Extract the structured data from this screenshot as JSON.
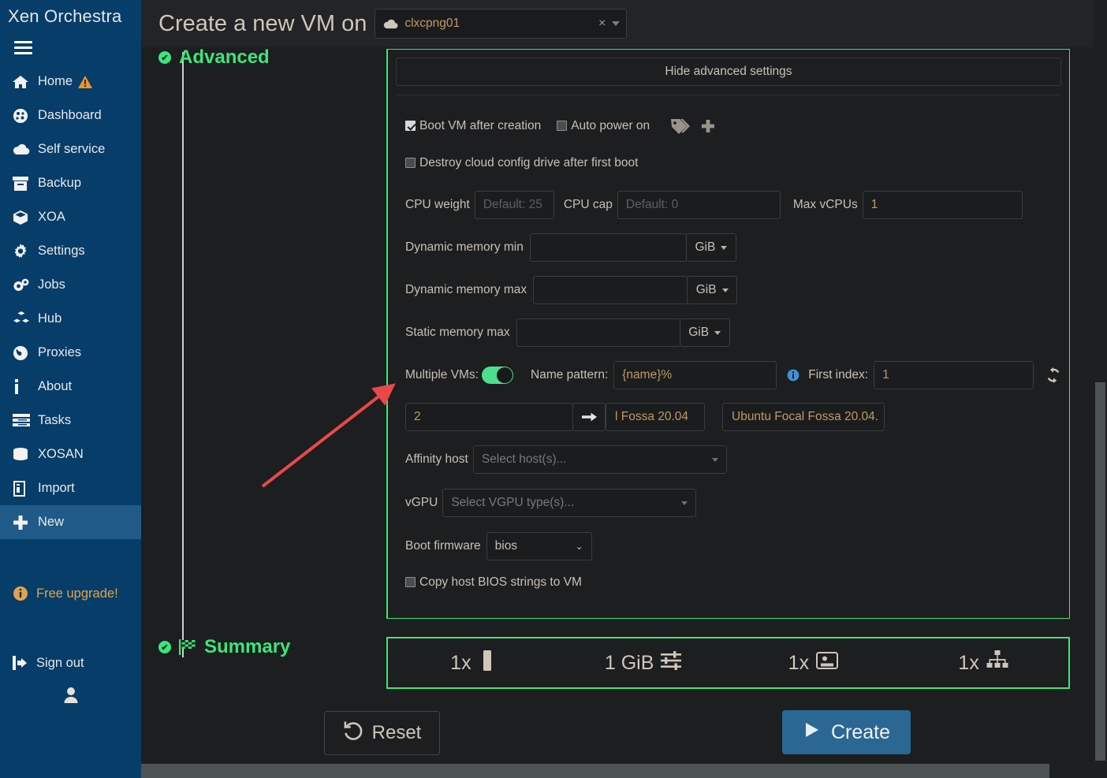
{
  "sidebar": {
    "brand": "Xen Orchestra",
    "menu_icon": "hamburger-icon",
    "items": [
      {
        "label": "Home",
        "icon": "home-icon",
        "badge": "warning-triangle-icon",
        "active": false
      },
      {
        "label": "Dashboard",
        "icon": "dashboard-icon",
        "active": false
      },
      {
        "label": "Self service",
        "icon": "cloud-icon",
        "active": false
      },
      {
        "label": "Backup",
        "icon": "archive-icon",
        "active": false
      },
      {
        "label": "XOA",
        "icon": "cube-icon",
        "active": false
      },
      {
        "label": "Settings",
        "icon": "gear-icon",
        "active": false
      },
      {
        "label": "Jobs",
        "icon": "gears-icon",
        "active": false
      },
      {
        "label": "Hub",
        "icon": "cubes-icon",
        "active": false
      },
      {
        "label": "Proxies",
        "icon": "globe-icon",
        "active": false
      },
      {
        "label": "About",
        "icon": "info-icon",
        "active": false
      },
      {
        "label": "Tasks",
        "icon": "tasks-icon",
        "active": false
      },
      {
        "label": "XOSAN",
        "icon": "database-icon",
        "active": false
      },
      {
        "label": "Import",
        "icon": "file-import-icon",
        "active": false
      },
      {
        "label": "New",
        "icon": "plus-icon",
        "active": true
      }
    ],
    "upgrade": {
      "label": "Free upgrade!",
      "icon": "info-circle-icon"
    },
    "signout": {
      "label": "Sign out",
      "icon": "sign-out-icon"
    },
    "avatar_icon": "user-icon"
  },
  "header": {
    "title": "Create a new VM on",
    "host_select": {
      "icon": "cloud-icon",
      "value": "clxcpng01",
      "clear": "×",
      "caret": "chevron-down-icon"
    }
  },
  "steps": {
    "advanced": {
      "label": "Advanced",
      "check": "✔"
    },
    "summary": {
      "label": "Summary",
      "check": "✔",
      "flag_icon": "checkered-flag-icon"
    }
  },
  "advanced": {
    "hide_advanced_label": "Hide advanced settings",
    "boot_vm": {
      "label": "Boot VM after creation",
      "checked": true
    },
    "auto_power": {
      "label": "Auto power on",
      "checked": false
    },
    "tags_icon": "tags-icon",
    "add_tag_icon": "plus-icon",
    "destroy_cloud_config": {
      "label": "Destroy cloud config drive after first boot",
      "checked": false
    },
    "cpu_weight": {
      "label": "CPU weight",
      "value": "",
      "placeholder": "Default: 25"
    },
    "cpu_cap": {
      "label": "CPU cap",
      "value": "",
      "placeholder": "Default: 0"
    },
    "max_vcpus": {
      "label": "Max vCPUs",
      "value": "1"
    },
    "dyn_mem_min": {
      "label": "Dynamic memory min",
      "value": "",
      "unit": "GiB"
    },
    "dyn_mem_max": {
      "label": "Dynamic memory max",
      "value": "",
      "unit": "GiB"
    },
    "static_mem_max": {
      "label": "Static memory max",
      "value": "",
      "unit": "GiB"
    },
    "multiple_vms": {
      "label": "Multiple VMs:",
      "enabled": true
    },
    "name_pattern": {
      "label": "Name pattern:",
      "value": "{name}%"
    },
    "name_pattern_info_icon": "info-circle-icon",
    "first_index": {
      "label": "First index:",
      "value": "1"
    },
    "refresh_icon": "refresh-icon",
    "vm_count": {
      "value": "2"
    },
    "apply_icon": "arrow-right-icon",
    "name_previews": [
      "l Fossa 20.04",
      "Ubuntu Focal Fossa 20.04."
    ],
    "affinity_host": {
      "label": "Affinity host",
      "placeholder": "Select host(s)..."
    },
    "vgpu": {
      "label": "vGPU",
      "placeholder": "Select VGPU type(s)..."
    },
    "boot_firmware": {
      "label": "Boot firmware",
      "value": "bios"
    },
    "copy_bios": {
      "label": "Copy host BIOS strings to VM",
      "checked": false
    }
  },
  "summary": {
    "items": [
      {
        "value": "1x",
        "icon": "cpu-icon"
      },
      {
        "value": "1 GiB",
        "icon": "memory-sliders-icon"
      },
      {
        "value": "1x",
        "icon": "disk-icon"
      },
      {
        "value": "1x",
        "icon": "network-icon"
      }
    ]
  },
  "actions": {
    "reset": {
      "label": "Reset",
      "icon": "undo-icon"
    },
    "create": {
      "label": "Create",
      "icon": "play-icon"
    }
  },
  "colors": {
    "sidebar_bg": "#063d69",
    "sidebar_active": "#1f5a88",
    "accent_green": "#3ce57b",
    "create_blue": "#2b6793",
    "input_text": "#c19a63",
    "upgrade_orange": "#e0a44a",
    "annotation_arrow": "#e8484a"
  }
}
